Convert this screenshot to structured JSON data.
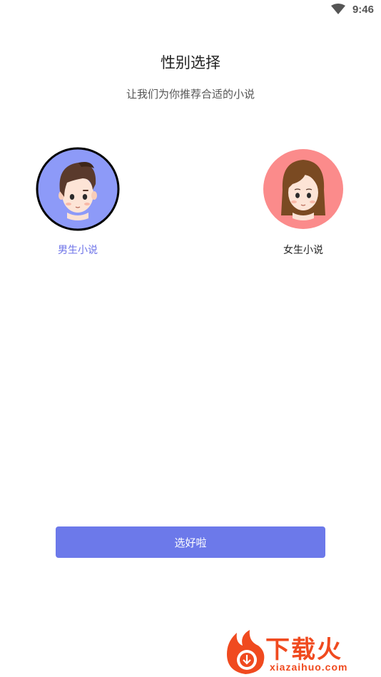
{
  "status_bar": {
    "time": "9:46",
    "wifi_icon": "wifi-icon"
  },
  "header": {
    "title": "性别选择",
    "subtitle": "让我们为你推荐合适的小说"
  },
  "options": [
    {
      "label": "男生小说",
      "icon": "male-avatar",
      "color": "#8d9af8",
      "selected": true
    },
    {
      "label": "女生小说",
      "icon": "female-avatar",
      "color": "#fb8b8b",
      "selected": false
    }
  ],
  "confirm_button": {
    "label": "选好啦",
    "color": "#6c79ea"
  },
  "colors": {
    "accent": "#6c72e8",
    "watermark": "#f04a1f"
  },
  "watermark": {
    "text": "下载火",
    "url": "xiazaihuo.com"
  }
}
